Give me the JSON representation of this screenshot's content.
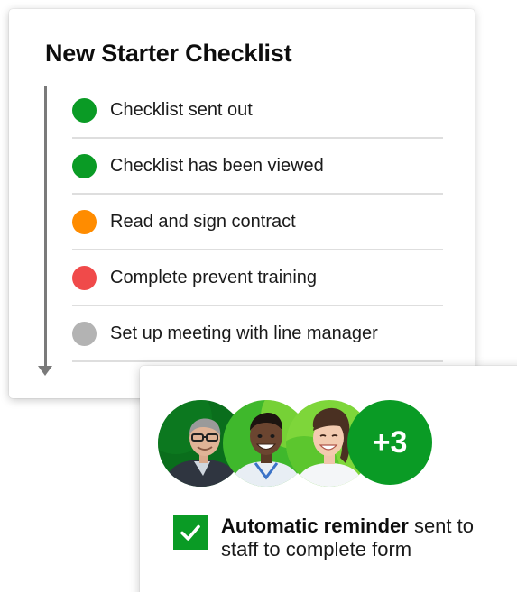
{
  "checklist": {
    "title": "New Starter Checklist",
    "items": [
      {
        "label": "Checklist sent out",
        "status": "complete",
        "color": "#0a9b25"
      },
      {
        "label": "Checklist has been viewed",
        "status": "complete",
        "color": "#0a9b25"
      },
      {
        "label": "Read and sign contract",
        "status": "in-progress",
        "color": "#ff8c00"
      },
      {
        "label": "Complete prevent training",
        "status": "overdue",
        "color": "#f04a4a"
      },
      {
        "label": "Set up meeting with line manager",
        "status": "not-started",
        "color": "#b3b3b3"
      }
    ]
  },
  "reminder": {
    "avatars": [
      {
        "icon": "person-man-glasses"
      },
      {
        "icon": "person-man-smiling"
      },
      {
        "icon": "person-woman-smiling"
      }
    ],
    "more_count": "+3",
    "bold_text": "Automatic reminder",
    "rest_text": " sent to staff to complete form",
    "check_icon": "checkmark-icon"
  },
  "colors": {
    "brand_green": "#0a9b25",
    "timeline_gray": "#7a7a7a"
  }
}
